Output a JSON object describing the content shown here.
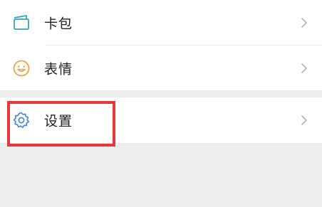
{
  "colors": {
    "page_background": "#ededed",
    "row_background": "#ffffff",
    "card_icon": "#2fa4b8",
    "emoji_icon": "#f0a43c",
    "settings_icon": "#4a86d8",
    "chevron": "#b2b2b2",
    "highlight": "#e8373a"
  },
  "menu": {
    "items": [
      {
        "label": "卡包",
        "icon": "card-wallet-icon"
      },
      {
        "label": "表情",
        "icon": "smiley-icon"
      },
      {
        "label": "设置",
        "icon": "gear-icon"
      }
    ]
  },
  "annotation": {
    "highlighted_item": "设置"
  }
}
